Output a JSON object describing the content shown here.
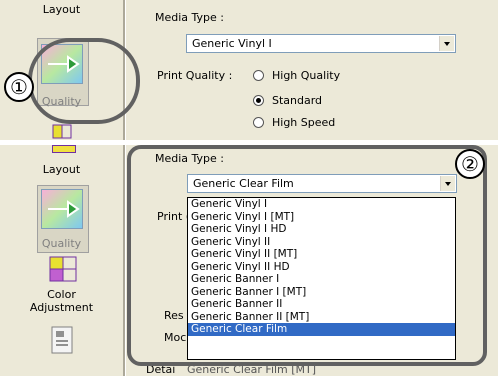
{
  "top_panel": {
    "sidebar": {
      "layout_label": "Layout",
      "quality_label": "Quality"
    },
    "media_type_label": "Media Type :",
    "media_type_value": "Generic Vinyl I",
    "print_quality_label": "Print Quality :",
    "quality_options": [
      "High Quality",
      "Standard",
      "High Speed"
    ],
    "selected_quality": "Standard"
  },
  "bottom_panel": {
    "sidebar": {
      "layout_label": "Layout",
      "quality_label": "Quality",
      "color_label_line1": "Color",
      "color_label_line2": "Adjustment"
    },
    "media_type_label": "Media Type :",
    "media_type_value": "Generic Clear Film",
    "print_partial": "Print (",
    "res_partial": "Res",
    "mod_partial": "Moc",
    "detail_partial": "Detai",
    "dropdown_options": [
      "Generic Vinyl I",
      "Generic Vinyl I [MT]",
      "Generic Vinyl I HD",
      "Generic Vinyl II",
      "Generic Vinyl II [MT]",
      "Generic Vinyl II HD",
      "Generic Banner I",
      "Generic Banner I [MT]",
      "Generic Banner II",
      "Generic Banner II [MT]",
      "Generic Clear Film"
    ],
    "selected_option": "Generic Clear Film",
    "below_list_partial": "Generic Clear Film [MT]"
  },
  "callouts": {
    "step1": "①",
    "step2": "②"
  }
}
